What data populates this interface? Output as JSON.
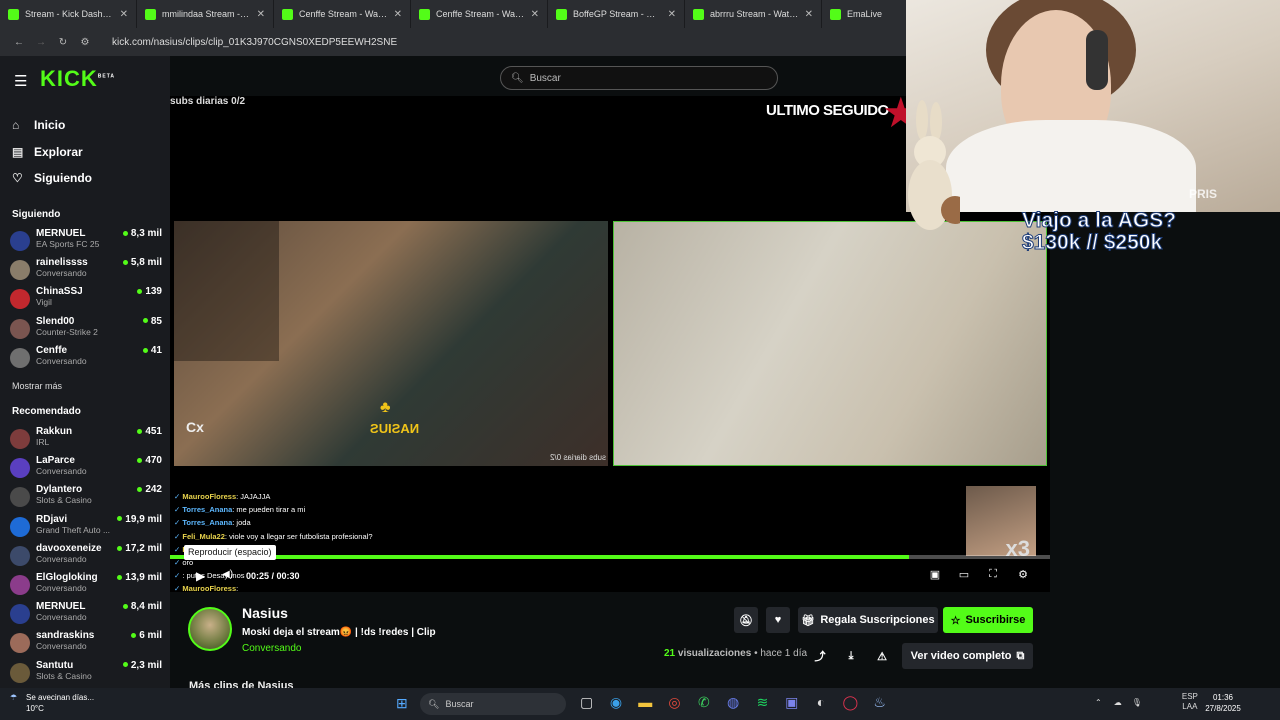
{
  "browser": {
    "tabs": [
      {
        "title": "Stream - Kick Dashboard",
        "color": "#53fc18"
      },
      {
        "title": "mmilindaa Stream - Watch Live",
        "color": "#53fc18"
      },
      {
        "title": "Cenffe Stream - Watch Live",
        "color": "#53fc18"
      },
      {
        "title": "Cenffe Stream - Watch Live",
        "color": "#53fc18"
      },
      {
        "title": "BoffeGP Stream - Watch Live",
        "color": "#53fc18"
      },
      {
        "title": "abrrru Stream - Watch Live",
        "color": "#53fc18"
      },
      {
        "title": "EmaLive",
        "color": "#53fc18"
      }
    ],
    "url": "kick.com/nasius/clips/clip_01K3J970CGNS0XEDP5EEWH2SNE"
  },
  "sidebar": {
    "logo": "KICK",
    "logo_badge": "BETA",
    "nav": [
      {
        "label": "Inicio",
        "icon": "home-icon"
      },
      {
        "label": "Explorar",
        "icon": "compass-icon"
      },
      {
        "label": "Siguiendo",
        "icon": "heart-icon"
      }
    ],
    "following_title": "Siguiendo",
    "following": [
      {
        "name": "MERNUEL",
        "category": "EA Sports FC 25",
        "viewers": "8,3 mil",
        "color": "#2a3f8f"
      },
      {
        "name": "rainelissss",
        "category": "Conversando",
        "viewers": "5,8 mil",
        "color": "#8a7d6a"
      },
      {
        "name": "ChinaSSJ",
        "category": "Vigil",
        "viewers": "139",
        "color": "#c2282e"
      },
      {
        "name": "Slend00",
        "category": "Counter-Strike 2",
        "viewers": "85",
        "color": "#7a5550"
      },
      {
        "name": "Cenffe",
        "category": "Conversando",
        "viewers": "41",
        "color": "#6f6f6f"
      }
    ],
    "show_more": "Mostrar más",
    "recommended_title": "Recomendado",
    "recommended": [
      {
        "name": "Rakkun",
        "category": "IRL",
        "viewers": "451",
        "color": "#7d3c3c"
      },
      {
        "name": "LaParce",
        "category": "Conversando",
        "viewers": "470",
        "color": "#5a3fc0"
      },
      {
        "name": "Dylantero",
        "category": "Slots & Casino",
        "viewers": "242",
        "color": "#4a4a4a"
      },
      {
        "name": "RDjavi",
        "category": "Grand Theft Auto ...",
        "viewers": "19,9 mil",
        "color": "#1e6bd6"
      },
      {
        "name": "davooxeneize",
        "category": "Conversando",
        "viewers": "17,2 mil",
        "color": "#3c4a6a"
      },
      {
        "name": "ElGlogloking",
        "category": "Conversando",
        "viewers": "13,9 mil",
        "color": "#8b3c8b"
      },
      {
        "name": "MERNUEL",
        "category": "Conversando",
        "viewers": "8,4 mil",
        "color": "#2a3f8f"
      },
      {
        "name": "sandraskins",
        "category": "Conversando",
        "viewers": "6 mil",
        "color": "#9c6b5a"
      },
      {
        "name": "Santutu",
        "category": "Slots & Casino",
        "viewers": "2,3 mil",
        "color": "#6a5a3a"
      }
    ]
  },
  "search": {
    "placeholder": "Buscar"
  },
  "player": {
    "overlay_subs": "subs diarias 0/2",
    "overlay_ultimo": "ULTIMO SEGUIDO",
    "cam1_subs": "subs diarias 0/2",
    "nasius_logo": "NASIUS",
    "cx_label": "Cx",
    "chat": [
      {
        "user": "MauroоFloress",
        "text": ": JAJAJJA",
        "gold": true
      },
      {
        "user": "Torres_Anana",
        "text": ": me pueden tirar a mi",
        "gold": false
      },
      {
        "user": "Torres_Anana",
        "text": ": joda",
        "gold": false
      },
      {
        "user": "Feli_Mula22",
        "text": ": viole voy a llegar ser futbolista profesional?",
        "gold": true
      },
      {
        "user": "Feli_",
        "text": "",
        "gold": true
      },
      {
        "user": "",
        "text": "oro",
        "gold": false
      },
      {
        "user": "",
        "text": ": putas Desayunos",
        "gold": false
      },
      {
        "user": "MauroоFloress",
        "text": ":",
        "gold": true
      }
    ],
    "x3_label": "x3",
    "tooltip": "Reproducir (espacio)",
    "progress": 0.84,
    "time": "00:25 / 00:30"
  },
  "clip": {
    "channel": "Nasius",
    "title": "Moski deja el stream😡 | !ds !redes | Clip",
    "category": "Conversando",
    "views_count": "21",
    "views_label": "visualizaciones",
    "ago": "• hace 1 día",
    "gift_label": "Regala Suscripciones",
    "subscribe_label": "Suscribirse",
    "full_video_label": "Ver video completo",
    "more_clips": "Más clips de Nasius"
  },
  "webcam": {
    "goal": "Viajo a la AGS?\n$130k // $250k",
    "watermark": "PRIS"
  },
  "taskbar": {
    "weather_line1": "Se avecinan días...",
    "weather_line2": "10°C",
    "search_placeholder": "Buscar",
    "lang1": "ESP",
    "lang2": "LAA",
    "time": "01:36",
    "date": "27/8/2025"
  }
}
